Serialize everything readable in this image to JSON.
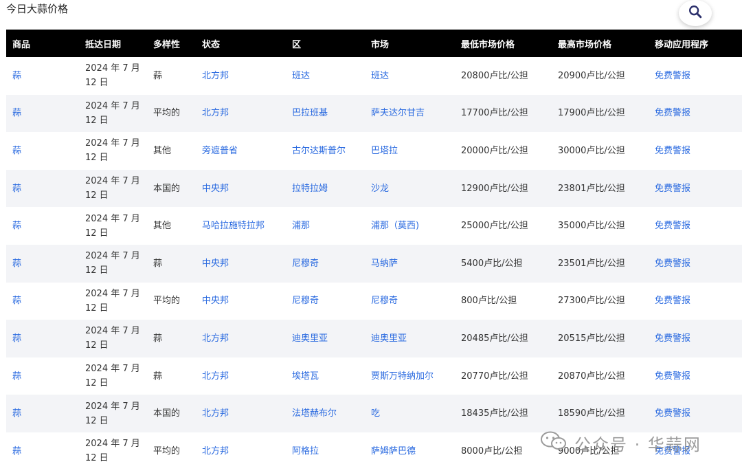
{
  "page": {
    "title": "今日大蒜价格"
  },
  "table": {
    "headers": [
      "商品",
      "抵达日期",
      "多样性",
      "状态",
      "区",
      "市场",
      "最低市场价格",
      "最高市场价格",
      "移动应用程序"
    ],
    "rows": [
      {
        "commodity": "蒜",
        "date": "2024 年 7 月 12 日",
        "variety": "蒜",
        "state": "北方邦",
        "district": "班达",
        "market": "班达",
        "min_price": "20800卢比/公担",
        "max_price": "20900卢比/公担",
        "app": "免费警报"
      },
      {
        "commodity": "蒜",
        "date": "2024 年 7 月 12 日",
        "variety": "平均的",
        "state": "北方邦",
        "district": "巴拉班基",
        "market": "萨夫达尔甘吉",
        "min_price": "17700卢比/公担",
        "max_price": "17900卢比/公担",
        "app": "免费警报"
      },
      {
        "commodity": "蒜",
        "date": "2024 年 7 月 12 日",
        "variety": "其他",
        "state": "旁遮普省",
        "district": "古尔达斯普尔",
        "market": "巴塔拉",
        "min_price": "20000卢比/公担",
        "max_price": "30000卢比/公担",
        "app": "免费警报"
      },
      {
        "commodity": "蒜",
        "date": "2024 年 7 月 12 日",
        "variety": "本国的",
        "state": "中央邦",
        "district": "拉特拉姆",
        "market": "沙龙",
        "min_price": "12900卢比/公担",
        "max_price": "23801卢比/公担",
        "app": "免费警报"
      },
      {
        "commodity": "蒜",
        "date": "2024 年 7 月 12 日",
        "variety": "其他",
        "state": "马哈拉施特拉邦",
        "district": "浦那",
        "market": "浦那（莫西)",
        "min_price": "25000卢比/公担",
        "max_price": "35000卢比/公担",
        "app": "免费警报"
      },
      {
        "commodity": "蒜",
        "date": "2024 年 7 月 12 日",
        "variety": "蒜",
        "state": "中央邦",
        "district": "尼穆奇",
        "market": "马纳萨",
        "min_price": "5400卢比/公担",
        "max_price": "23501卢比/公担",
        "app": "免费警报"
      },
      {
        "commodity": "蒜",
        "date": "2024 年 7 月 12 日",
        "variety": "平均的",
        "state": "中央邦",
        "district": "尼穆奇",
        "market": "尼穆奇",
        "min_price": "800卢比/公担",
        "max_price": "27300卢比/公担",
        "app": "免费警报"
      },
      {
        "commodity": "蒜",
        "date": "2024 年 7 月 12 日",
        "variety": "蒜",
        "state": "北方邦",
        "district": "迪奥里亚",
        "market": "迪奥里亚",
        "min_price": "20485卢比/公担",
        "max_price": "20515卢比/公担",
        "app": "免费警报"
      },
      {
        "commodity": "蒜",
        "date": "2024 年 7 月 12 日",
        "variety": "蒜",
        "state": "北方邦",
        "district": "埃塔瓦",
        "market": "贾斯万特纳加尔",
        "min_price": "20770卢比/公担",
        "max_price": "20870卢比/公担",
        "app": "免费警报"
      },
      {
        "commodity": "蒜",
        "date": "2024 年 7 月 12 日",
        "variety": "本国的",
        "state": "北方邦",
        "district": "法塔赫布尔",
        "market": "吃",
        "min_price": "18435卢比/公担",
        "max_price": "18590卢比/公担",
        "app": "免费警报"
      },
      {
        "commodity": "蒜",
        "date": "2024 年 7 月 12 日",
        "variety": "平均的",
        "state": "北方邦",
        "district": "阿格拉",
        "market": "萨姆萨巴德",
        "min_price": "8000卢比/公担",
        "max_price": "9000卢比/公担",
        "app": "免费警报"
      }
    ]
  },
  "watermark": {
    "text": "公众号 · 华蒜网"
  },
  "icons": {
    "search": "search-icon",
    "watermark": "wechat-icon"
  },
  "colors": {
    "header_bg": "#000000",
    "link": "#2a6ae0",
    "row_alt": "#f3f4f7"
  }
}
